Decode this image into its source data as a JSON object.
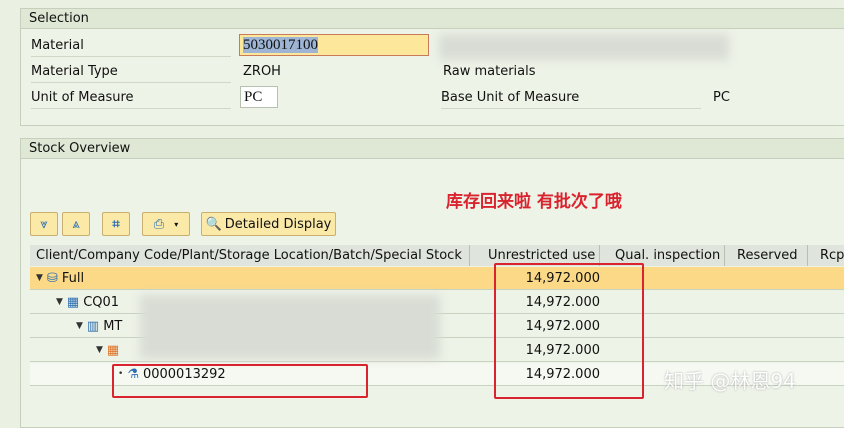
{
  "selection": {
    "title": "Selection",
    "material_label": "Material",
    "material_value": "5030017100",
    "material_type_label": "Material Type",
    "material_type_value": "ZROH",
    "material_type_desc": "Raw materials",
    "uom_label": "Unit of Measure",
    "uom_value": "PC",
    "base_uom_label": "Base Unit of Measure",
    "base_uom_value": "PC"
  },
  "stock": {
    "title": "Stock Overview",
    "annotation": "库存回来啦 有批次了哦",
    "detailed_display": "Detailed Display",
    "columns": [
      "Client/Company Code/Plant/Storage Location/Batch/Special Stock",
      "Unrestricted use",
      "Qual. inspection",
      "Reserved",
      "Rcp"
    ],
    "rows": [
      {
        "label": "Full",
        "value": "14,972.000"
      },
      {
        "label": "CQ01",
        "value": "14,972.000"
      },
      {
        "label": "MT",
        "value": "14,972.000"
      },
      {
        "label": "",
        "value": "14,972.000"
      },
      {
        "label": "0000013292",
        "value": "14,972.000"
      }
    ]
  },
  "watermark": "知乎 @林恩94",
  "colors": {
    "highlight": "#fbd986",
    "annotation": "#d9232e"
  }
}
